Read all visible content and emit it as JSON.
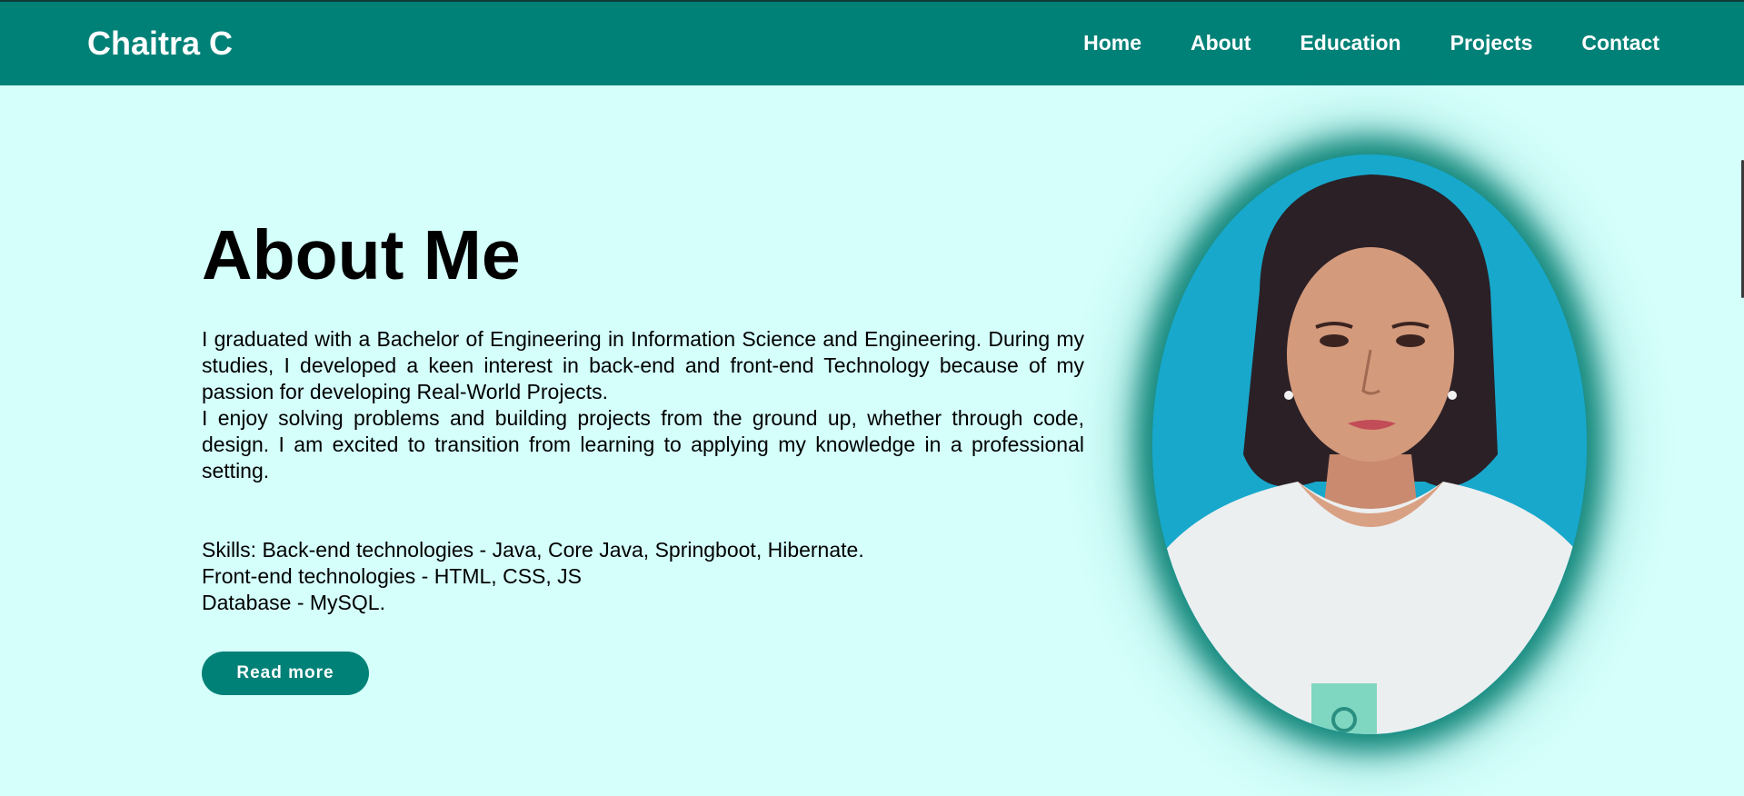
{
  "header": {
    "logo": "Chaitra C",
    "nav": [
      {
        "label": "Home"
      },
      {
        "label": "About"
      },
      {
        "label": "Education"
      },
      {
        "label": "Projects"
      },
      {
        "label": "Contact"
      }
    ]
  },
  "about": {
    "title": "About Me",
    "paragraph_1": "I graduated with a Bachelor of Engineering in Information Science and Engineering. During my studies, I developed a keen interest in back-end and front-end Technology because of my passion for developing Real-World Projects.",
    "paragraph_2": "I enjoy solving problems and building projects from the ground up, whether through code, design. I am excited to transition from learning to applying my knowledge in a professional setting.",
    "skills_backend": "Skills: Back-end technologies - Java, Core Java, Springboot, Hibernate.",
    "skills_frontend": "Front-end technologies - HTML, CSS, JS",
    "skills_database": "Database - MySQL.",
    "read_more": "Read more"
  },
  "colors": {
    "primary": "#008177",
    "background": "#d4fffb",
    "text": "#000000"
  }
}
